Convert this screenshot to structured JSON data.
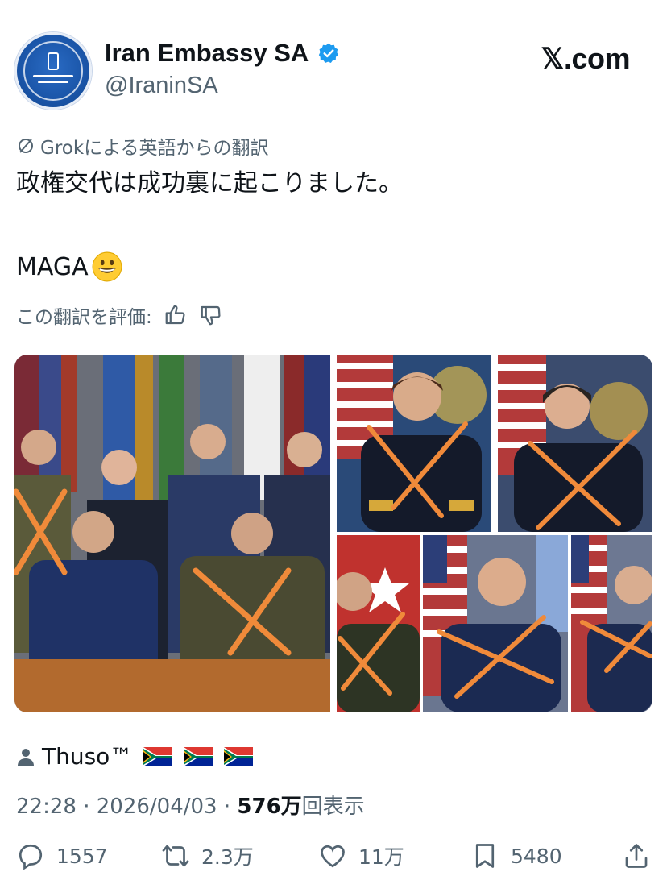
{
  "account": {
    "display_name": "Iran Embassy SA",
    "handle": "@IraninSA",
    "verified": true,
    "avatar": "iran-embassy-seal"
  },
  "site_label": "𝕏.com",
  "translation": {
    "label": "Grokによる英語からの翻訳",
    "icon": "translate-slash-icon"
  },
  "tweet": {
    "line1": "政権交代は成功裏に起こりました。",
    "line2": "MAGA",
    "emoji": "grinning-face"
  },
  "rating": {
    "label": "この翻訳を評価:",
    "thumbs_up_icon": "thumbs-up-icon",
    "thumbs_down_icon": "thumbs-down-icon"
  },
  "media": {
    "images": [
      "group-photo-officers",
      "portrait-admiral",
      "portrait-officer-woman",
      "portrait-army-general",
      "portrait-air-force-general",
      "portrait-air-force-officer"
    ],
    "overlay": "orange-x-marks"
  },
  "credit": {
    "name": "Thuso™",
    "flags": [
      "south-africa-flag",
      "south-africa-flag",
      "south-africa-flag"
    ]
  },
  "meta": {
    "time": "22:28",
    "date": "2026/04/03",
    "views_count": "576万",
    "views_label": "回表示",
    "separator": "·"
  },
  "actions": {
    "replies": "1557",
    "reposts": "2.3万",
    "likes": "11万",
    "bookmarks": "5480"
  },
  "colors": {
    "x_orange": "#f08a3a",
    "verified_blue": "#1d9bf0",
    "text_primary": "#0f1419",
    "text_secondary": "#536471"
  }
}
